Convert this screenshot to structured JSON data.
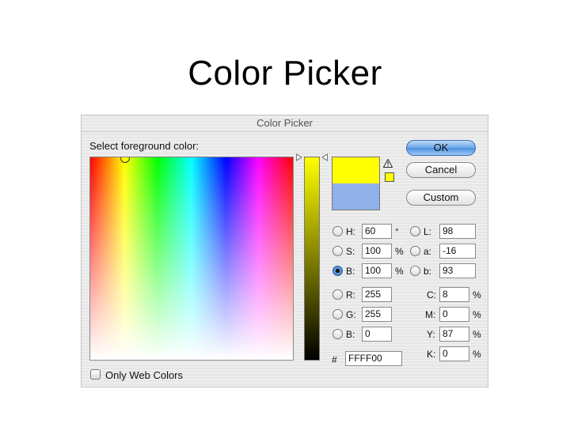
{
  "slide": {
    "title": "Color Picker"
  },
  "dialog": {
    "title": "Color Picker",
    "prompt": "Select foreground color:",
    "buttons": {
      "ok": "OK",
      "cancel": "Cancel",
      "custom": "Custom"
    },
    "swatches": {
      "new_color": "#ffff00",
      "old_color": "#8fb0e8"
    },
    "hsb": [
      {
        "label": "H:",
        "value": "60",
        "unit": "°",
        "selected": false
      },
      {
        "label": "S:",
        "value": "100",
        "unit": "%",
        "selected": false
      },
      {
        "label": "B:",
        "value": "100",
        "unit": "%",
        "selected": true
      }
    ],
    "lab": [
      {
        "label": "L:",
        "value": "98",
        "selected": false
      },
      {
        "label": "a:",
        "value": "-16",
        "selected": false
      },
      {
        "label": "b:",
        "value": "93",
        "selected": false
      }
    ],
    "rgb": [
      {
        "label": "R:",
        "value": "255",
        "selected": false
      },
      {
        "label": "G:",
        "value": "255",
        "selected": false
      },
      {
        "label": "B:",
        "value": "0",
        "selected": false
      }
    ],
    "cmyk": [
      {
        "label": "C:",
        "value": "8",
        "unit": "%"
      },
      {
        "label": "M:",
        "value": "0",
        "unit": "%"
      },
      {
        "label": "Y:",
        "value": "87",
        "unit": "%"
      },
      {
        "label": "K:",
        "value": "0",
        "unit": "%"
      }
    ],
    "hex": {
      "prefix": "#",
      "value": "FFFF00"
    },
    "web_colors": {
      "label": "Only Web Colors",
      "checked": false
    },
    "icons": {
      "gamut_warning": "warning-triangle-icon",
      "websafe_swatch": "websafe-cube-swatch"
    }
  }
}
